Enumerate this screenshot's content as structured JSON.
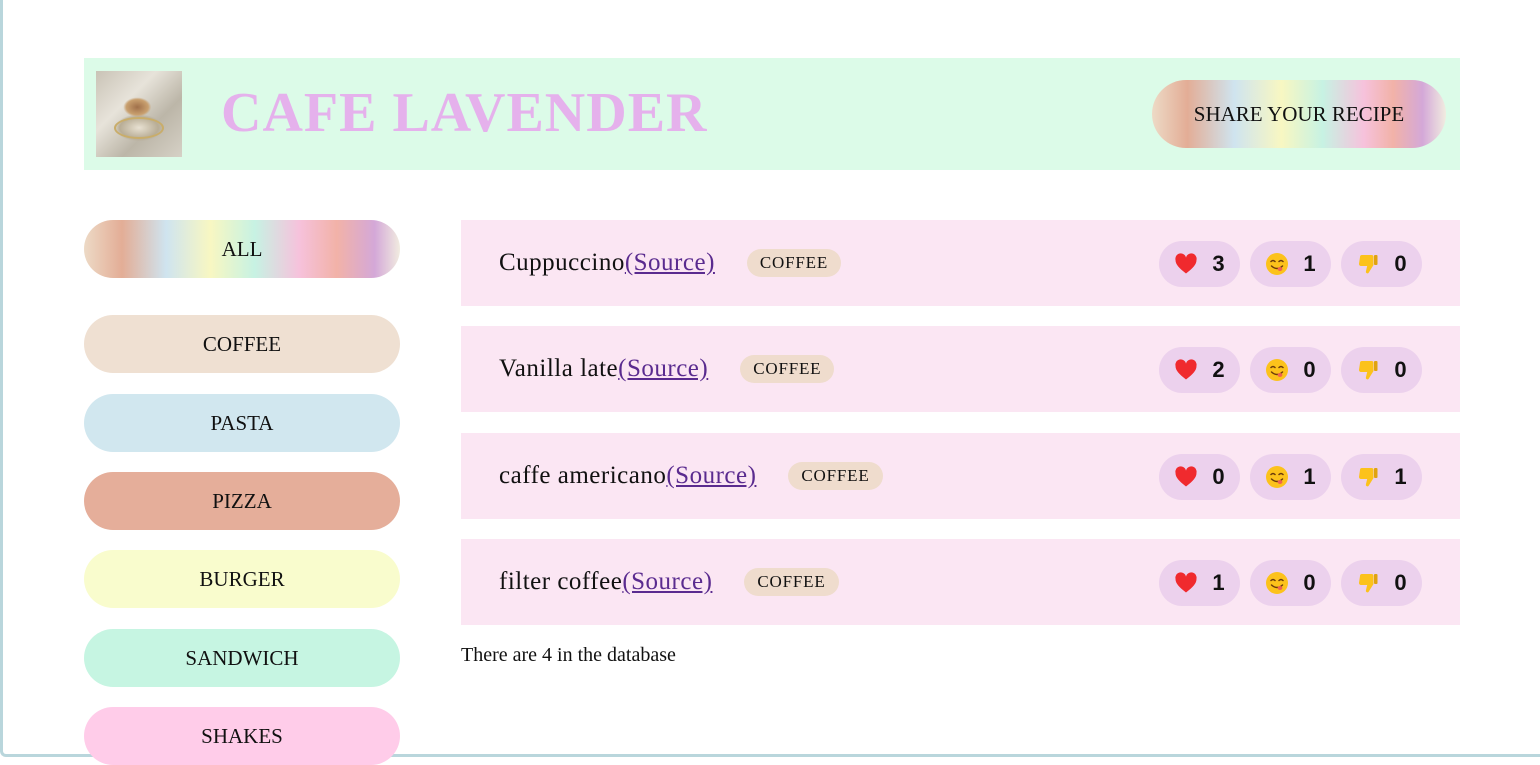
{
  "header": {
    "title": "CAFE LAVENDER",
    "share_label": "SHARE YOUR RECIPE",
    "logo_icon": "coffee-cup-photo"
  },
  "sidebar": {
    "items": [
      {
        "label": "ALL",
        "color": "rainbow-gradient"
      },
      {
        "label": "COFFEE",
        "color": "#efe0d2"
      },
      {
        "label": "PASTA",
        "color": "#d1e7ef"
      },
      {
        "label": "PIZZA",
        "color": "#e5ae9a"
      },
      {
        "label": "BURGER",
        "color": "#f9fccd"
      },
      {
        "label": "SANDWICH",
        "color": "#c6f5e2"
      },
      {
        "label": "SHAKES",
        "color": "#ffcce9"
      }
    ]
  },
  "recipes": [
    {
      "name": "Cuppuccino",
      "source": "(Source)",
      "category": "COFFEE",
      "likes": "3",
      "yum": "1",
      "dislikes": "0"
    },
    {
      "name": "Vanilla late",
      "source": "(Source)",
      "category": "COFFEE",
      "likes": "2",
      "yum": "0",
      "dislikes": "0"
    },
    {
      "name": "caffe americano",
      "source": "(Source)",
      "category": "COFFEE",
      "likes": "0",
      "yum": "1",
      "dislikes": "1"
    },
    {
      "name": "filter coffee",
      "source": "(Source)",
      "category": "COFFEE",
      "likes": "1",
      "yum": "0",
      "dislikes": "0"
    }
  ],
  "footer": {
    "count_text": "There are 4 in the database"
  },
  "icons": {
    "like": "red-heart-icon",
    "yum": "face-savoring-food-icon",
    "dislike": "thumbs-down-icon"
  },
  "colors": {
    "header_bg": "#dcfbe8",
    "title": "#e5b1ec",
    "row_bg": "#fbe6f3",
    "reaction_bg": "#ecd1ed",
    "tag_bg": "#efdccd",
    "link": "#5a2b8f"
  }
}
